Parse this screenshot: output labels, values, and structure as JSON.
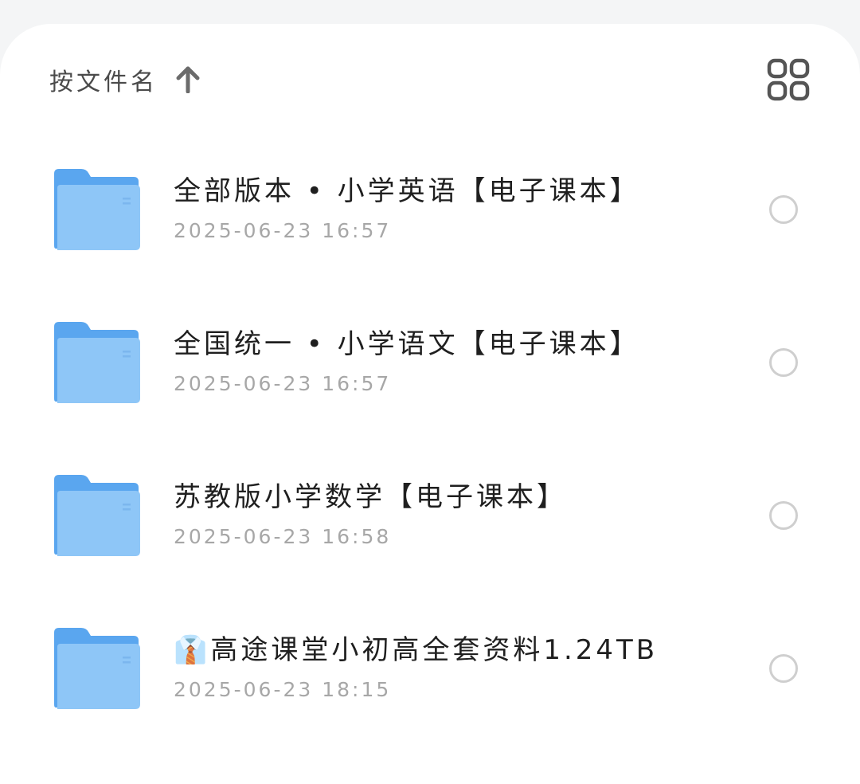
{
  "header": {
    "sort_label": "按文件名",
    "sort_arrow_icon": "arrow-up-icon",
    "view_toggle_icon": "grid-view-icon"
  },
  "colors": {
    "folder_back": "#5aa6ef",
    "folder_front": "#8ec6f7",
    "title_text": "#1f1f1f",
    "date_text": "#a7a7a7",
    "circle_border": "#cfcfcf"
  },
  "files": [
    {
      "name": "全部版本 • 小学英语【电子课本】",
      "date": "2025-06-23 16:57",
      "icon": "folder-icon"
    },
    {
      "name": "全国统一 • 小学语文【电子课本】",
      "date": "2025-06-23 16:57",
      "icon": "folder-icon"
    },
    {
      "name": "苏教版小学数学【电子课本】",
      "date": "2025-06-23 16:58",
      "icon": "folder-icon"
    },
    {
      "name": "👔高途课堂小初高全套资料1.24TB",
      "date": "2025-06-23 18:15",
      "icon": "folder-icon"
    }
  ]
}
